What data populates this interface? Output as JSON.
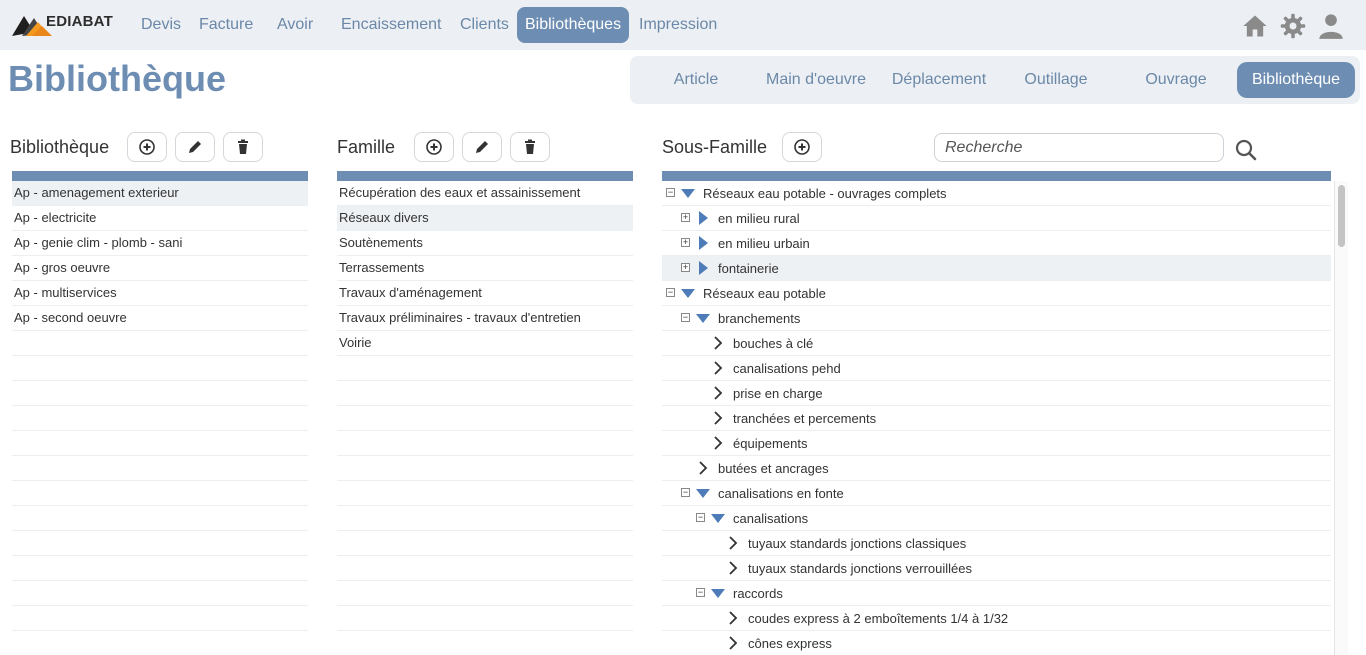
{
  "app": {
    "logo_text": "EDIABAT"
  },
  "nav": {
    "items": [
      {
        "label": "Devis",
        "active": false
      },
      {
        "label": "Facture",
        "active": false
      },
      {
        "label": "Avoir",
        "active": false
      },
      {
        "label": "Encaissement",
        "active": false
      },
      {
        "label": "Clients",
        "active": false
      },
      {
        "label": "Bibliothèques",
        "active": true
      },
      {
        "label": "Impression",
        "active": false
      }
    ],
    "icons": [
      "home-icon",
      "gear-icon",
      "user-icon"
    ]
  },
  "page": {
    "title": "Bibliothèque"
  },
  "subtabs": [
    {
      "label": "Article",
      "active": false
    },
    {
      "label": "Main d'oeuvre",
      "active": false
    },
    {
      "label": "Déplacement",
      "active": false
    },
    {
      "label": "Outillage",
      "active": false
    },
    {
      "label": "Ouvrage",
      "active": false
    },
    {
      "label": "Bibliothèque",
      "active": true
    }
  ],
  "bibliotheque": {
    "title": "Bibliothèque",
    "actions": [
      "add-icon",
      "edit-icon",
      "delete-icon"
    ],
    "items": [
      "Ap - amenagement exterieur",
      "Ap - electricite",
      "Ap - genie clim - plomb - sani",
      "Ap - gros oeuvre",
      "Ap - multiservices",
      "Ap - second oeuvre"
    ],
    "selected_index": 0
  },
  "famille": {
    "title": "Famille",
    "actions": [
      "add-icon",
      "edit-icon",
      "delete-icon"
    ],
    "items": [
      "Récupération des eaux et assainissement",
      "Réseaux divers",
      "Soutènements",
      "Terrassements",
      "Travaux d'aménagement",
      "Travaux préliminaires - travaux d'entretien",
      "Voirie"
    ],
    "selected_index": 1
  },
  "sous_famille": {
    "title": "Sous-Famille",
    "search_placeholder": "Recherche",
    "tree": [
      {
        "label": "Réseaux eau potable - ouvrages complets",
        "level": 0,
        "toggle": "minus",
        "arrow": "down-filled",
        "selected": false
      },
      {
        "label": "en milieu rural",
        "level": 1,
        "toggle": "plus",
        "arrow": "right-filled",
        "selected": false
      },
      {
        "label": "en milieu urbain",
        "level": 1,
        "toggle": "plus",
        "arrow": "right-filled",
        "selected": false
      },
      {
        "label": "fontainerie",
        "level": 1,
        "toggle": "plus",
        "arrow": "right-filled",
        "selected": true
      },
      {
        "label": "Réseaux eau potable",
        "level": 0,
        "toggle": "minus",
        "arrow": "down-filled",
        "selected": false
      },
      {
        "label": "branchements",
        "level": 1,
        "toggle": "minus",
        "arrow": "down-filled",
        "selected": false
      },
      {
        "label": "bouches à clé",
        "level": 2,
        "toggle": "",
        "arrow": "chevron",
        "selected": false
      },
      {
        "label": "canalisations pehd",
        "level": 2,
        "toggle": "",
        "arrow": "chevron",
        "selected": false
      },
      {
        "label": "prise en charge",
        "level": 2,
        "toggle": "",
        "arrow": "chevron",
        "selected": false
      },
      {
        "label": "tranchées et percements",
        "level": 2,
        "toggle": "",
        "arrow": "chevron",
        "selected": false
      },
      {
        "label": "équipements",
        "level": 2,
        "toggle": "",
        "arrow": "chevron",
        "selected": false
      },
      {
        "label": "butées et ancrages",
        "level": 1,
        "toggle": "",
        "arrow": "chevron",
        "selected": false
      },
      {
        "label": "canalisations en fonte",
        "level": 1,
        "toggle": "minus",
        "arrow": "down-filled",
        "selected": false
      },
      {
        "label": "canalisations",
        "level": 2,
        "toggle": "minus",
        "arrow": "down-filled",
        "selected": false
      },
      {
        "label": "tuyaux standards jonctions classiques",
        "level": 3,
        "toggle": "",
        "arrow": "chevron",
        "selected": false
      },
      {
        "label": "tuyaux standards jonctions verrouillées",
        "level": 3,
        "toggle": "",
        "arrow": "chevron",
        "selected": false
      },
      {
        "label": "raccords",
        "level": 2,
        "toggle": "minus",
        "arrow": "down-filled",
        "selected": false
      },
      {
        "label": "coudes express à 2 emboîtements 1/4 à 1/32",
        "level": 3,
        "toggle": "",
        "arrow": "chevron",
        "selected": false
      },
      {
        "label": "cônes express",
        "level": 3,
        "toggle": "",
        "arrow": "chevron",
        "selected": false
      }
    ]
  },
  "colors": {
    "accent": "#6d8db3",
    "nav_bg": "#ecf0f4",
    "selected_row": "#eef1f4"
  }
}
